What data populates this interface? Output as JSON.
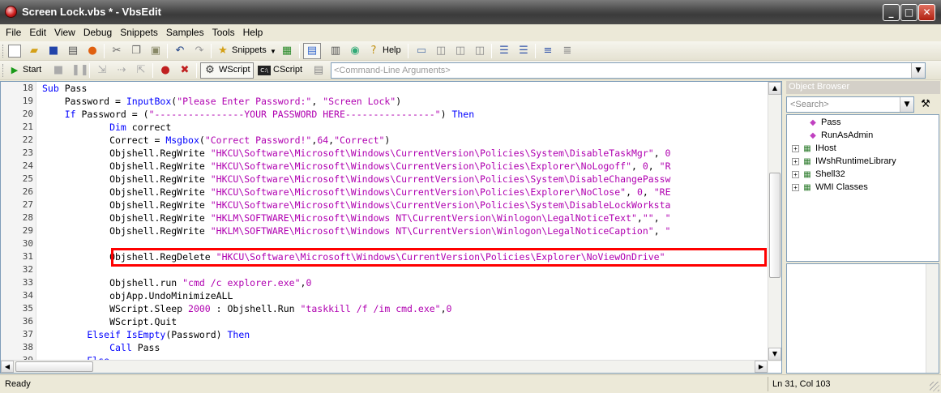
{
  "window": {
    "title": "Screen Lock.vbs * - VbsEdit"
  },
  "menu": [
    "File",
    "Edit",
    "View",
    "Debug",
    "Snippets",
    "Samples",
    "Tools",
    "Help"
  ],
  "toolbar1": {
    "snippets_label": "Snippets",
    "help_label": "Help"
  },
  "toolbar2": {
    "start_label": "Start",
    "wscript_label": "WScript",
    "cscript_label": "CScript",
    "cmdline_placeholder": "<Command-Line Arguments>"
  },
  "editor": {
    "highlighted_line": 31,
    "lines": [
      {
        "n": "18",
        "tokens": [
          [
            "kw",
            "Sub "
          ],
          [
            "pl",
            "Pass"
          ]
        ]
      },
      {
        "n": "19",
        "tokens": [
          [
            "pl",
            "    Password = "
          ],
          [
            "fn",
            "InputBox"
          ],
          [
            "pl",
            "("
          ],
          [
            "st",
            "\"Please Enter Password:\""
          ],
          [
            "pl",
            ", "
          ],
          [
            "st",
            "\"Screen Lock\""
          ],
          [
            "pl",
            ")"
          ]
        ]
      },
      {
        "n": "20",
        "tokens": [
          [
            "kw",
            "    If "
          ],
          [
            "pl",
            "Password = ("
          ],
          [
            "st",
            "\"----------------YOUR PASSWORD HERE----------------\""
          ],
          [
            "pl",
            ") "
          ],
          [
            "kw",
            "Then"
          ]
        ]
      },
      {
        "n": "21",
        "tokens": [
          [
            "kw",
            "            Dim "
          ],
          [
            "pl",
            "correct"
          ]
        ]
      },
      {
        "n": "22",
        "tokens": [
          [
            "pl",
            "            Correct = "
          ],
          [
            "fn",
            "Msgbox"
          ],
          [
            "pl",
            "("
          ],
          [
            "st",
            "\"Correct Password!\""
          ],
          [
            "pl",
            ","
          ],
          [
            "nm",
            "64"
          ],
          [
            "pl",
            ","
          ],
          [
            "st",
            "\"Correct\""
          ],
          [
            "pl",
            ")"
          ]
        ]
      },
      {
        "n": "23",
        "tokens": [
          [
            "pl",
            "            Objshell.RegWrite "
          ],
          [
            "st",
            "\"HKCU\\Software\\Microsoft\\Windows\\CurrentVersion\\Policies\\System\\DisableTaskMgr\""
          ],
          [
            "pl",
            ", "
          ],
          [
            "nm",
            "0"
          ]
        ]
      },
      {
        "n": "24",
        "tokens": [
          [
            "pl",
            "            Objshell.RegWrite "
          ],
          [
            "st",
            "\"HKCU\\Software\\Microsoft\\Windows\\CurrentVersion\\Policies\\Explorer\\NoLogoff\""
          ],
          [
            "pl",
            ", "
          ],
          [
            "nm",
            "0"
          ],
          [
            "pl",
            ", "
          ],
          [
            "st",
            "\"R"
          ]
        ]
      },
      {
        "n": "25",
        "tokens": [
          [
            "pl",
            "            Objshell.RegWrite "
          ],
          [
            "st",
            "\"HKCU\\Software\\Microsoft\\Windows\\CurrentVersion\\Policies\\System\\DisableChangePassw"
          ]
        ]
      },
      {
        "n": "26",
        "tokens": [
          [
            "pl",
            "            Objshell.RegWrite "
          ],
          [
            "st",
            "\"HKCU\\Software\\Microsoft\\Windows\\CurrentVersion\\Policies\\Explorer\\NoClose\""
          ],
          [
            "pl",
            ", "
          ],
          [
            "nm",
            "0"
          ],
          [
            "pl",
            ", "
          ],
          [
            "st",
            "\"RE"
          ]
        ]
      },
      {
        "n": "27",
        "tokens": [
          [
            "pl",
            "            Objshell.RegWrite "
          ],
          [
            "st",
            "\"HKCU\\Software\\Microsoft\\Windows\\CurrentVersion\\Policies\\System\\DisableLockWorksta"
          ]
        ]
      },
      {
        "n": "28",
        "tokens": [
          [
            "pl",
            "            Objshell.RegWrite "
          ],
          [
            "st",
            "\"HKLM\\SOFTWARE\\Microsoft\\Windows NT\\CurrentVersion\\Winlogon\\LegalNoticeText\""
          ],
          [
            "pl",
            ","
          ],
          [
            "st",
            "\"\""
          ],
          [
            "pl",
            ", "
          ],
          [
            "st",
            "\""
          ]
        ]
      },
      {
        "n": "29",
        "tokens": [
          [
            "pl",
            "            Objshell.RegWrite "
          ],
          [
            "st",
            "\"HKLM\\SOFTWARE\\Microsoft\\Windows NT\\CurrentVersion\\Winlogon\\LegalNoticeCaption\""
          ],
          [
            "pl",
            ", "
          ],
          [
            "st",
            "\""
          ]
        ]
      },
      {
        "n": "30",
        "tokens": [
          [
            "pl",
            ""
          ]
        ]
      },
      {
        "n": "31",
        "tokens": [
          [
            "pl",
            "            Objshell.RegDelete "
          ],
          [
            "st",
            "\"HKCU\\Software\\Microsoft\\Windows\\CurrentVersion\\Policies\\Explorer\\NoViewOnDrive\""
          ]
        ]
      },
      {
        "n": "32",
        "tokens": [
          [
            "pl",
            ""
          ]
        ]
      },
      {
        "n": "33",
        "tokens": [
          [
            "pl",
            "            Objshell.run "
          ],
          [
            "st",
            "\"cmd /c explorer.exe\""
          ],
          [
            "pl",
            ","
          ],
          [
            "nm",
            "0"
          ]
        ]
      },
      {
        "n": "34",
        "tokens": [
          [
            "pl",
            "            objApp.UndoMinimizeALL"
          ]
        ]
      },
      {
        "n": "35",
        "tokens": [
          [
            "pl",
            "            WScript.Sleep "
          ],
          [
            "nm",
            "2000"
          ],
          [
            "pl",
            " : Objshell.Run "
          ],
          [
            "st",
            "\"taskkill /f /im cmd.exe\""
          ],
          [
            "pl",
            ","
          ],
          [
            "nm",
            "0"
          ]
        ]
      },
      {
        "n": "36",
        "tokens": [
          [
            "pl",
            "            WScript.Quit"
          ]
        ]
      },
      {
        "n": "37",
        "tokens": [
          [
            "kw",
            "        Elseif "
          ],
          [
            "fn",
            "IsEmpty"
          ],
          [
            "pl",
            "(Password) "
          ],
          [
            "kw",
            "Then"
          ]
        ]
      },
      {
        "n": "38",
        "tokens": [
          [
            "kw",
            "            Call "
          ],
          [
            "pl",
            "Pass"
          ]
        ]
      },
      {
        "n": "39",
        "tokens": [
          [
            "kw",
            "        Else"
          ]
        ]
      }
    ]
  },
  "object_browser": {
    "header": "Object Browser",
    "search_placeholder": "<Search>",
    "items": [
      {
        "label": "Pass",
        "expandable": false,
        "icon": "method-icon"
      },
      {
        "label": "RunAsAdmin",
        "expandable": false,
        "icon": "method-icon"
      },
      {
        "label": "IHost",
        "expandable": true,
        "icon": "library-icon"
      },
      {
        "label": "IWshRuntimeLibrary",
        "expandable": true,
        "icon": "library-icon"
      },
      {
        "label": "Shell32",
        "expandable": true,
        "icon": "library-icon"
      },
      {
        "label": "WMI Classes",
        "expandable": true,
        "icon": "library-icon"
      }
    ]
  },
  "status": {
    "left": "Ready",
    "position": "Ln 31, Col 103"
  },
  "colors": {
    "keyword": "#0000FF",
    "string": "#B000B0",
    "highlight_box": "#FF0000"
  }
}
